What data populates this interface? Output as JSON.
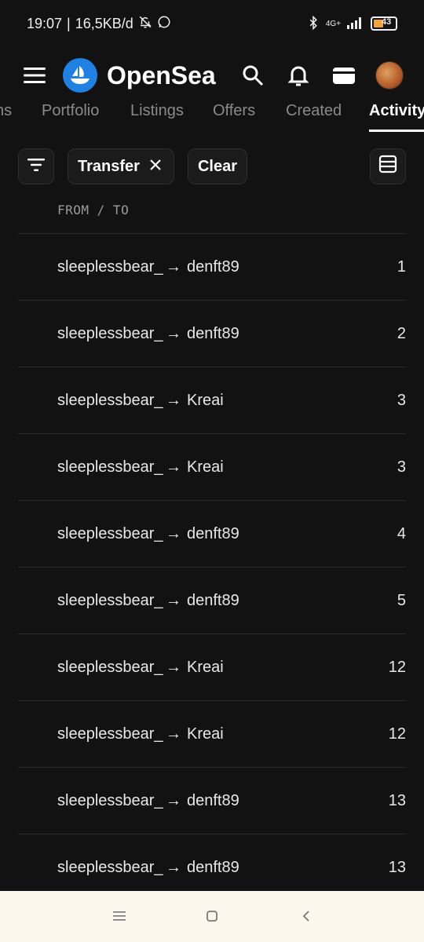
{
  "status_bar": {
    "time": "19:07",
    "network_speed": "16,5KB/d",
    "battery_level": "43",
    "network_type": "4G+"
  },
  "header": {
    "brand_name": "OpenSea",
    "menu_icon": "hamburger-menu-icon",
    "search_icon": "search-icon",
    "notification_icon": "bell-icon",
    "wallet_icon": "wallet-icon",
    "accent_color": "#2081e2"
  },
  "tabs": [
    {
      "label": "ns"
    },
    {
      "label": "Portfolio"
    },
    {
      "label": "Listings"
    },
    {
      "label": "Offers"
    },
    {
      "label": "Created"
    },
    {
      "label": "Activity",
      "active": true
    }
  ],
  "filters": {
    "chips": [
      {
        "label": "Transfer",
        "removable": true
      }
    ],
    "clear_label": "Clear"
  },
  "table": {
    "column_header": "FROM / TO",
    "rows": [
      {
        "from": "sleeplessbear_",
        "to": "denft89",
        "qty": "1"
      },
      {
        "from": "sleeplessbear_",
        "to": "denft89",
        "qty": "2"
      },
      {
        "from": "sleeplessbear_",
        "to": "Kreai",
        "qty": "3"
      },
      {
        "from": "sleeplessbear_",
        "to": "Kreai",
        "qty": "3"
      },
      {
        "from": "sleeplessbear_",
        "to": "denft89",
        "qty": "4"
      },
      {
        "from": "sleeplessbear_",
        "to": "denft89",
        "qty": "5"
      },
      {
        "from": "sleeplessbear_",
        "to": "Kreai",
        "qty": "12"
      },
      {
        "from": "sleeplessbear_",
        "to": "Kreai",
        "qty": "12"
      },
      {
        "from": "sleeplessbear_",
        "to": "denft89",
        "qty": "13"
      },
      {
        "from": "sleeplessbear_",
        "to": "denft89",
        "qty": "13"
      }
    ]
  }
}
